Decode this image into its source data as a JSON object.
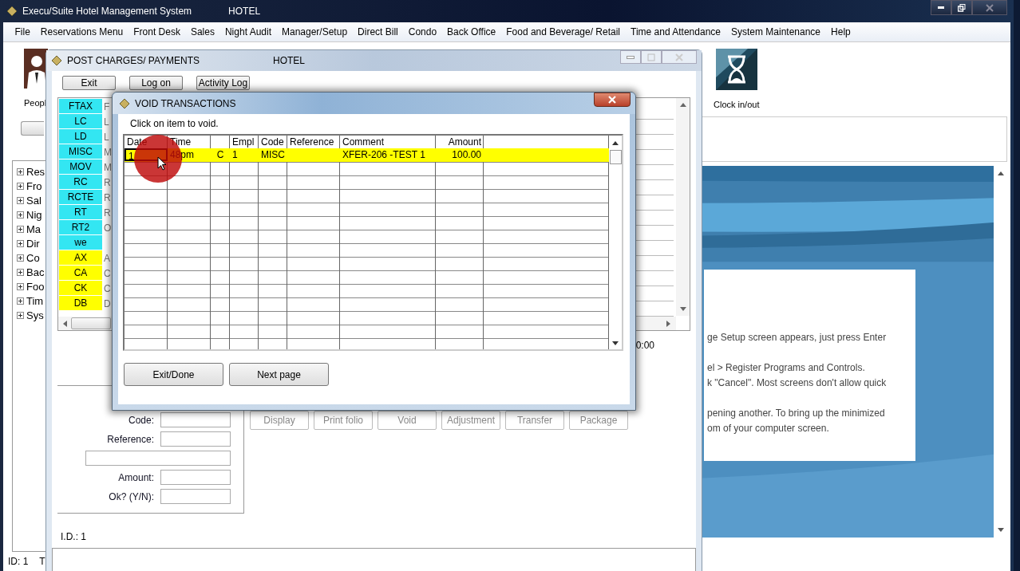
{
  "app": {
    "title": "Execu/Suite Hotel Management System",
    "subtitle": "HOTEL"
  },
  "menu": [
    {
      "label": "File"
    },
    {
      "label": "Reservations Menu"
    },
    {
      "label": "Front Desk"
    },
    {
      "label": "Sales"
    },
    {
      "label": "Night Audit"
    },
    {
      "label": "Manager/Setup"
    },
    {
      "label": "Direct Bill"
    },
    {
      "label": "Condo"
    },
    {
      "label": "Back Office"
    },
    {
      "label": "Food and Beverage/ Retail"
    },
    {
      "label": "Time and Attendance"
    },
    {
      "label": "System Maintenance"
    },
    {
      "label": "Help"
    }
  ],
  "toolbar": [
    {
      "kind": "people",
      "label": "Peopl"
    },
    {
      "kind": "clock",
      "label": "Clock in/out"
    }
  ],
  "tree": [
    {
      "label": "Res",
      "expanded": false
    },
    {
      "label": "Fro",
      "expanded": false
    },
    {
      "label": "Sal",
      "expanded": false
    },
    {
      "label": "Nig",
      "expanded": false
    },
    {
      "label": "Ma",
      "expanded": false
    },
    {
      "label": "Dir",
      "expanded": false
    },
    {
      "label": "Co",
      "expanded": false
    },
    {
      "label": "Bac",
      "expanded": false
    },
    {
      "label": "Foo",
      "expanded": false
    },
    {
      "label": "Tim",
      "expanded": false
    },
    {
      "label": "Sys",
      "expanded": false
    }
  ],
  "status_bar": {
    "id": "ID: 1",
    "column_2": "T"
  },
  "help_panel": {
    "lines": [
      {
        "text": "ge Setup screen appears, just press Enter"
      },
      {
        "text": "el > Register Programs and Controls."
      },
      {
        "text": "k \"Cancel\". Most screens don't allow quick"
      },
      {
        "text": "pening another. To bring up the minimized"
      },
      {
        "text": "om of your computer screen."
      }
    ]
  },
  "post_window": {
    "title": "POST CHARGES/ PAYMENTS",
    "subtitle": "HOTEL",
    "buttons": [
      {
        "label": "Exit"
      },
      {
        "label": "Log on"
      },
      {
        "label": "Activity Log"
      }
    ],
    "codes": [
      {
        "code": "FTAX",
        "column_2": "F",
        "color": "#33e6f2"
      },
      {
        "code": "LC",
        "column_2": "L",
        "color": "#33e6f2"
      },
      {
        "code": "LD",
        "column_2": "L",
        "color": "#33e6f2"
      },
      {
        "code": "MISC",
        "column_2": "M",
        "color": "#33e6f2"
      },
      {
        "code": "MOV",
        "column_2": "M",
        "color": "#33e6f2"
      },
      {
        "code": "RC",
        "column_2": "R",
        "color": "#33e6f2"
      },
      {
        "code": "RCTE",
        "column_2": "R",
        "color": "#33e6f2"
      },
      {
        "code": "RT",
        "column_2": "R",
        "color": "#33e6f2"
      },
      {
        "code": "RT2",
        "column_2": "O",
        "color": "#33e6f2"
      },
      {
        "code": "we",
        "color": "#33e6f2"
      },
      {
        "code": "AX",
        "column_2": "A",
        "color": "#ffff00"
      },
      {
        "code": "CA",
        "column_2": "C",
        "color": "#ffff00"
      },
      {
        "code": "CK",
        "column_2": "C",
        "color": "#ffff00"
      },
      {
        "code": "DB",
        "column_2": "D",
        "color": "#ffff00"
      }
    ],
    "time_text": "0:00",
    "fields": [
      {
        "kind": "labeled",
        "label": "Code:"
      },
      {
        "kind": "labeled",
        "label": "Reference:"
      },
      {
        "kind": "wide"
      },
      {
        "kind": "labeled",
        "label": "Amount:"
      },
      {
        "kind": "labeled",
        "label": "Ok? (Y/N):"
      }
    ],
    "actions": [
      {
        "label": "Display",
        "disabled": true
      },
      {
        "label": "Print folio",
        "disabled": true
      },
      {
        "label": "Void",
        "disabled": true
      },
      {
        "label": "Adjustment",
        "disabled": true
      },
      {
        "label": "Transfer",
        "disabled": true
      },
      {
        "label": "Package",
        "disabled": true
      }
    ],
    "id_text": "I.D.: 1"
  },
  "void_dialog": {
    "title": "VOID TRANSACTIONS",
    "instruction": "Click on item to void.",
    "columns": {
      "date": "Date",
      "time": "Time",
      "empl": "Empl",
      "code": "Code",
      "reference": "Reference",
      "comment": "Comment",
      "amount": "Amount"
    },
    "rows": [
      {
        "date": "1",
        "time": "48pm",
        "column_3": "C",
        "empl": "1",
        "code": "MISC",
        "comment": "XFER-206 -TEST 1",
        "amount": "100.00",
        "selected": true
      }
    ],
    "buttons": [
      {
        "label": "Exit/Done"
      },
      {
        "label": "Next page"
      }
    ]
  }
}
